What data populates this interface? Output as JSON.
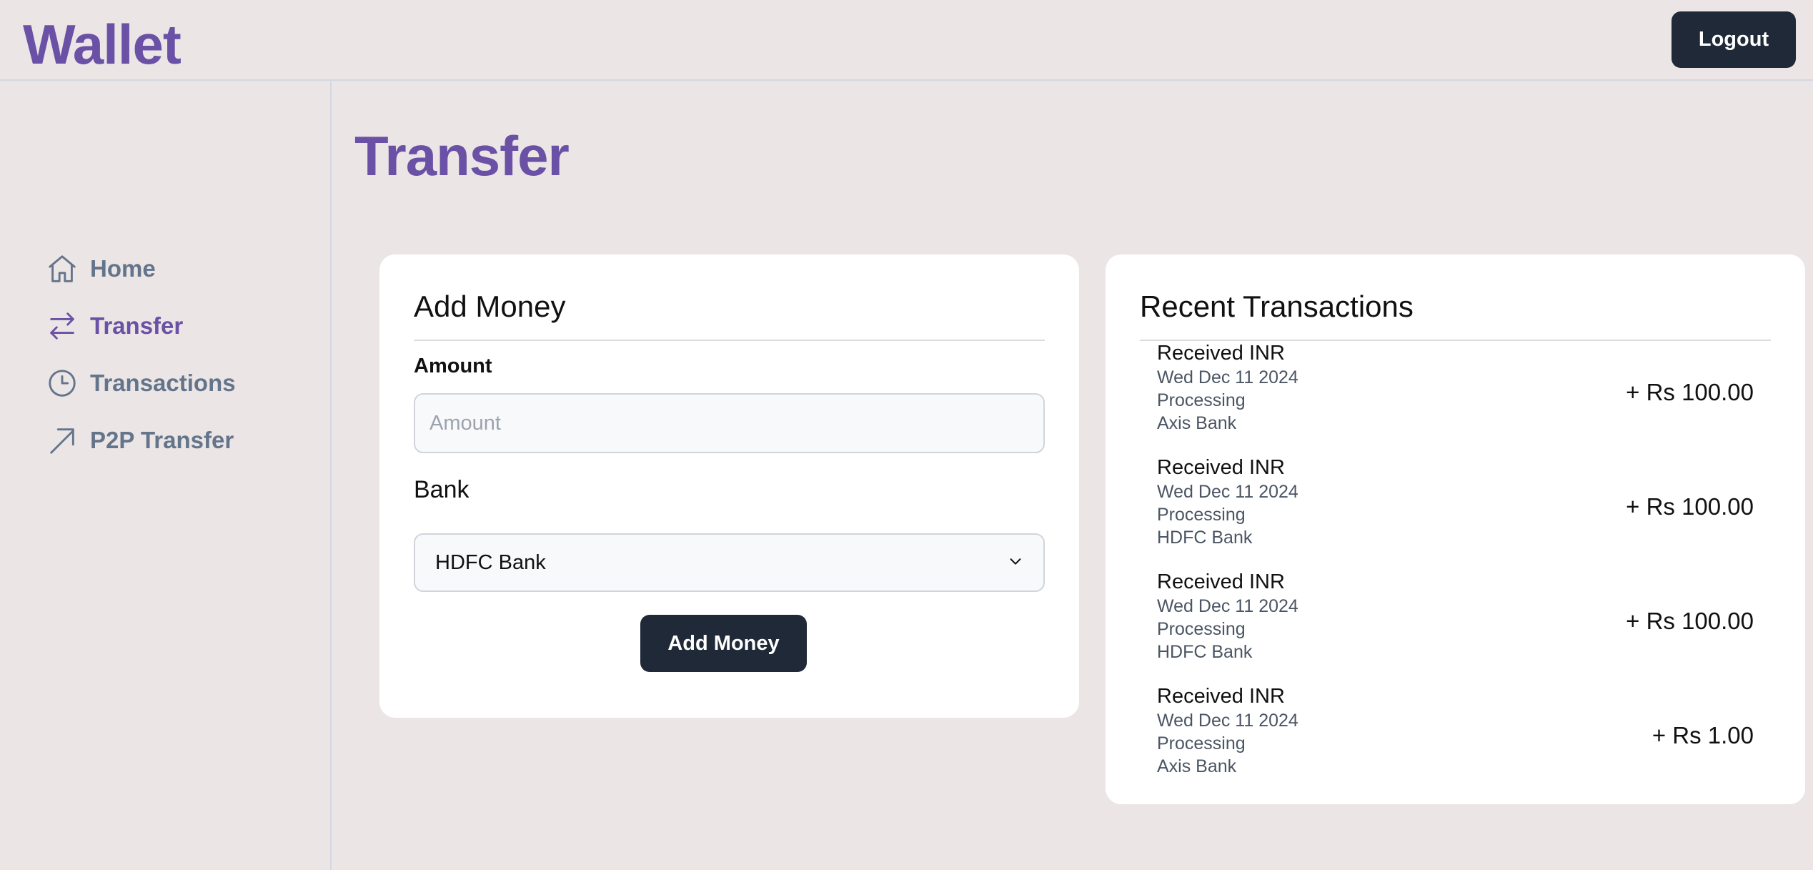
{
  "header": {
    "brand": "Wallet",
    "logout_label": "Logout"
  },
  "sidebar": {
    "items": [
      {
        "label": "Home",
        "icon": "home-icon",
        "active": false
      },
      {
        "label": "Transfer",
        "icon": "arrows-swap-icon",
        "active": true
      },
      {
        "label": "Transactions",
        "icon": "clock-icon",
        "active": false
      },
      {
        "label": "P2P Transfer",
        "icon": "arrow-up-right-icon",
        "active": false
      }
    ]
  },
  "main": {
    "title": "Transfer"
  },
  "add_money": {
    "title": "Add Money",
    "amount_label": "Amount",
    "amount_placeholder": "Amount",
    "amount_value": "",
    "bank_label": "Bank",
    "bank_selected": "HDFC Bank",
    "button_label": "Add Money"
  },
  "recent_transactions": {
    "title": "Recent Transactions",
    "items": [
      {
        "title": "Received INR",
        "date": "Wed Dec 11 2024",
        "status": "Processing",
        "bank": "Axis Bank",
        "amount": "+ Rs 100.00"
      },
      {
        "title": "Received INR",
        "date": "Wed Dec 11 2024",
        "status": "Processing",
        "bank": "HDFC Bank",
        "amount": "+ Rs 100.00"
      },
      {
        "title": "Received INR",
        "date": "Wed Dec 11 2024",
        "status": "Processing",
        "bank": "HDFC Bank",
        "amount": "+ Rs 100.00"
      },
      {
        "title": "Received INR",
        "date": "Wed Dec 11 2024",
        "status": "Processing",
        "bank": "Axis Bank",
        "amount": "+ Rs 1.00"
      }
    ]
  },
  "colors": {
    "brand": "#6a51a6",
    "background": "#ebe6e5",
    "button": "#1f2937",
    "nav_inactive": "#64748b"
  }
}
